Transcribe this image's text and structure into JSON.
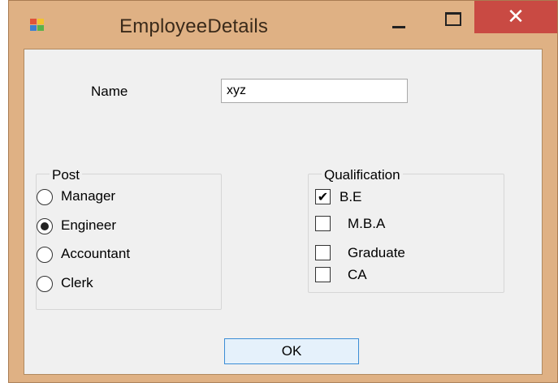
{
  "window": {
    "title": "EmployeeDetails",
    "close_glyph": "✕",
    "icons": {
      "app": "app-form-icon",
      "minimize": "minimize-icon",
      "maximize": "maximize-icon",
      "close": "close-icon"
    },
    "colors": {
      "frame": "#dfb184",
      "close_button": "#c94a43",
      "client": "#f0f0f0"
    }
  },
  "form": {
    "name_label": "Name",
    "name_value": "xyz",
    "post": {
      "title": "Post",
      "options": [
        {
          "label": "Manager",
          "checked": false
        },
        {
          "label": "Engineer",
          "checked": true
        },
        {
          "label": "Accountant",
          "checked": false
        },
        {
          "label": "Clerk",
          "checked": false
        }
      ]
    },
    "qualification": {
      "title": "Qualification",
      "options": [
        {
          "label": "B.E",
          "checked": true
        },
        {
          "label": "M.B.A",
          "checked": false
        },
        {
          "label": "Graduate",
          "checked": false
        },
        {
          "label": "CA",
          "checked": false
        }
      ]
    },
    "ok_label": "OK"
  }
}
